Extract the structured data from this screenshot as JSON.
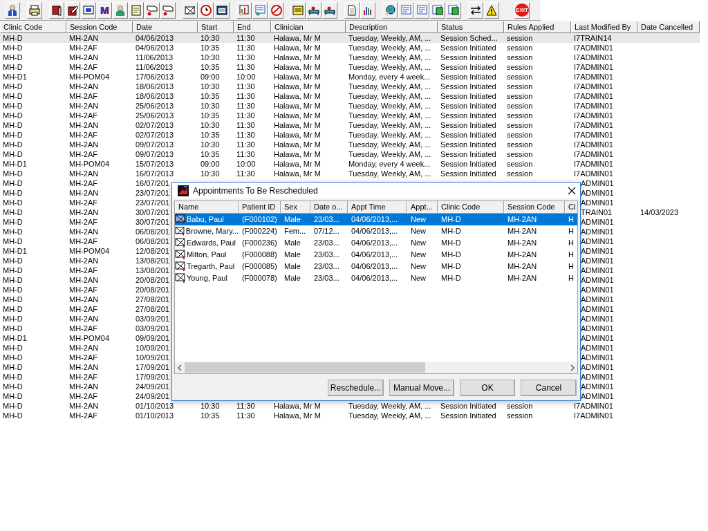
{
  "toolbar": {
    "letter_button": "M",
    "exit_button": "EXIT"
  },
  "table": {
    "columns": [
      "Clinic Code",
      "Session Code",
      "Date",
      "Start",
      "End",
      "Clinician",
      "Description",
      "Status",
      "Rules Applied",
      "Last Modified By",
      "Date Cancelled"
    ],
    "rows": [
      {
        "kind": "full",
        "selected": true,
        "cells": [
          "MH-D",
          "MH-2AN",
          "04/06/2013",
          "10:30",
          "11:30",
          "Halawa, Mr M",
          "Tuesday, Weekly, AM, ...",
          "Session Sched...",
          "session",
          "I7TRAIN14"
        ]
      },
      {
        "kind": "full",
        "selected": false,
        "cells": [
          "MH-D",
          "MH-2AF",
          "04/06/2013",
          "10:35",
          "11:30",
          "Halawa, Mr M",
          "Tuesday, Weekly, AM, ...",
          "Session Initiated",
          "session",
          "I7ADMIN01"
        ]
      },
      {
        "kind": "full",
        "selected": false,
        "cells": [
          "MH-D",
          "MH-2AN",
          "11/06/2013",
          "10:30",
          "11:30",
          "Halawa, Mr M",
          "Tuesday, Weekly, AM, ...",
          "Session Initiated",
          "session",
          "I7ADMIN01"
        ]
      },
      {
        "kind": "full",
        "selected": false,
        "cells": [
          "MH-D",
          "MH-2AF",
          "11/06/2013",
          "10:35",
          "11:30",
          "Halawa, Mr M",
          "Tuesday, Weekly, AM, ...",
          "Session Initiated",
          "session",
          "I7ADMIN01"
        ]
      },
      {
        "kind": "full",
        "selected": false,
        "cells": [
          "MH-D1",
          "MH-POM04",
          "17/06/2013",
          "09:00",
          "10:00",
          "Halawa, Mr M",
          "Monday, every 4 week...",
          "Session Initiated",
          "session",
          "I7ADMIN01"
        ]
      },
      {
        "kind": "full",
        "selected": false,
        "cells": [
          "MH-D",
          "MH-2AN",
          "18/06/2013",
          "10:30",
          "11:30",
          "Halawa, Mr M",
          "Tuesday, Weekly, AM, ...",
          "Session Initiated",
          "session",
          "I7ADMIN01"
        ]
      },
      {
        "kind": "full",
        "selected": false,
        "cells": [
          "MH-D",
          "MH-2AF",
          "18/06/2013",
          "10:35",
          "11:30",
          "Halawa, Mr M",
          "Tuesday, Weekly, AM, ...",
          "Session Initiated",
          "session",
          "I7ADMIN01"
        ]
      },
      {
        "kind": "full",
        "selected": false,
        "cells": [
          "MH-D",
          "MH-2AN",
          "25/06/2013",
          "10:30",
          "11:30",
          "Halawa, Mr M",
          "Tuesday, Weekly, AM, ...",
          "Session Initiated",
          "session",
          "I7ADMIN01"
        ]
      },
      {
        "kind": "full",
        "selected": false,
        "cells": [
          "MH-D",
          "MH-2AF",
          "25/06/2013",
          "10:35",
          "11:30",
          "Halawa, Mr M",
          "Tuesday, Weekly, AM, ...",
          "Session Initiated",
          "session",
          "I7ADMIN01"
        ]
      },
      {
        "kind": "full",
        "selected": false,
        "cells": [
          "MH-D",
          "MH-2AN",
          "02/07/2013",
          "10:30",
          "11:30",
          "Halawa, Mr M",
          "Tuesday, Weekly, AM, ...",
          "Session Initiated",
          "session",
          "I7ADMIN01"
        ]
      },
      {
        "kind": "full",
        "selected": false,
        "cells": [
          "MH-D",
          "MH-2AF",
          "02/07/2013",
          "10:35",
          "11:30",
          "Halawa, Mr M",
          "Tuesday, Weekly, AM, ...",
          "Session Initiated",
          "session",
          "I7ADMIN01"
        ]
      },
      {
        "kind": "full",
        "selected": false,
        "cells": [
          "MH-D",
          "MH-2AN",
          "09/07/2013",
          "10:30",
          "11:30",
          "Halawa, Mr M",
          "Tuesday, Weekly, AM, ...",
          "Session Initiated",
          "session",
          "I7ADMIN01"
        ]
      },
      {
        "kind": "full",
        "selected": false,
        "cells": [
          "MH-D",
          "MH-2AF",
          "09/07/2013",
          "10:35",
          "11:30",
          "Halawa, Mr M",
          "Tuesday, Weekly, AM, ...",
          "Session Initiated",
          "session",
          "I7ADMIN01"
        ]
      },
      {
        "kind": "full",
        "selected": false,
        "cells": [
          "MH-D1",
          "MH-POM04",
          "15/07/2013",
          "09:00",
          "10:00",
          "Halawa, Mr M",
          "Monday, every 4 week...",
          "Session Initiated",
          "session",
          "I7ADMIN01"
        ]
      },
      {
        "kind": "full",
        "selected": false,
        "cells": [
          "MH-D",
          "MH-2AN",
          "16/07/2013",
          "10:30",
          "11:30",
          "Halawa, Mr M",
          "Tuesday, Weekly, AM, ...",
          "Session Initiated",
          "session",
          "I7ADMIN01"
        ]
      },
      {
        "kind": "partly_hidden",
        "selected": false,
        "cells": [
          "MH-D",
          "MH-2AF",
          "16/07/201"
        ],
        "last_modified_by": "ADMIN01"
      },
      {
        "kind": "partly_hidden",
        "selected": false,
        "cells": [
          "MH-D",
          "MH-2AN",
          "23/07/201"
        ],
        "last_modified_by": "ADMIN01"
      },
      {
        "kind": "partly_hidden",
        "selected": false,
        "cells": [
          "MH-D",
          "MH-2AF",
          "23/07/201"
        ],
        "last_modified_by": "ADMIN01"
      },
      {
        "kind": "partly_hidden",
        "selected": false,
        "cells": [
          "MH-D",
          "MH-2AN",
          "30/07/201"
        ],
        "last_modified_by": "TRAIN01",
        "date_cancelled": "14/03/2023"
      },
      {
        "kind": "partly_hidden",
        "selected": false,
        "cells": [
          "MH-D",
          "MH-2AF",
          "30/07/201"
        ],
        "last_modified_by": "ADMIN01"
      },
      {
        "kind": "partly_hidden",
        "selected": false,
        "cells": [
          "MH-D",
          "MH-2AN",
          "06/08/201"
        ],
        "last_modified_by": "ADMIN01"
      },
      {
        "kind": "partly_hidden",
        "selected": false,
        "cells": [
          "MH-D",
          "MH-2AF",
          "06/08/201"
        ],
        "last_modified_by": "ADMIN01"
      },
      {
        "kind": "partly_hidden",
        "selected": false,
        "cells": [
          "MH-D1",
          "MH-POM04",
          "12/08/201"
        ],
        "last_modified_by": "ADMIN01"
      },
      {
        "kind": "partly_hidden",
        "selected": false,
        "cells": [
          "MH-D",
          "MH-2AN",
          "13/08/201"
        ],
        "last_modified_by": "ADMIN01"
      },
      {
        "kind": "partly_hidden",
        "selected": false,
        "cells": [
          "MH-D",
          "MH-2AF",
          "13/08/201"
        ],
        "last_modified_by": "ADMIN01"
      },
      {
        "kind": "partly_hidden",
        "selected": false,
        "cells": [
          "MH-D",
          "MH-2AN",
          "20/08/201"
        ],
        "last_modified_by": "ADMIN01"
      },
      {
        "kind": "partly_hidden",
        "selected": false,
        "cells": [
          "MH-D",
          "MH-2AF",
          "20/08/201"
        ],
        "last_modified_by": "ADMIN01"
      },
      {
        "kind": "partly_hidden",
        "selected": false,
        "cells": [
          "MH-D",
          "MH-2AN",
          "27/08/201"
        ],
        "last_modified_by": "ADMIN01"
      },
      {
        "kind": "partly_hidden",
        "selected": false,
        "cells": [
          "MH-D",
          "MH-2AF",
          "27/08/201"
        ],
        "last_modified_by": "ADMIN01"
      },
      {
        "kind": "partly_hidden",
        "selected": false,
        "cells": [
          "MH-D",
          "MH-2AN",
          "03/09/201"
        ],
        "last_modified_by": "ADMIN01"
      },
      {
        "kind": "partly_hidden",
        "selected": false,
        "cells": [
          "MH-D",
          "MH-2AF",
          "03/09/201"
        ],
        "last_modified_by": "ADMIN01"
      },
      {
        "kind": "partly_hidden",
        "selected": false,
        "cells": [
          "MH-D1",
          "MH-POM04",
          "09/09/201"
        ],
        "last_modified_by": "ADMIN01"
      },
      {
        "kind": "partly_hidden",
        "selected": false,
        "cells": [
          "MH-D",
          "MH-2AN",
          "10/09/201"
        ],
        "last_modified_by": "ADMIN01"
      },
      {
        "kind": "partly_hidden",
        "selected": false,
        "cells": [
          "MH-D",
          "MH-2AF",
          "10/09/201"
        ],
        "last_modified_by": "ADMIN01"
      },
      {
        "kind": "partly_hidden",
        "selected": false,
        "cells": [
          "MH-D",
          "MH-2AN",
          "17/09/201"
        ],
        "last_modified_by": "ADMIN01"
      },
      {
        "kind": "partly_hidden",
        "selected": false,
        "cells": [
          "MH-D",
          "MH-2AF",
          "17/09/201"
        ],
        "last_modified_by": "ADMIN01"
      },
      {
        "kind": "partly_hidden",
        "selected": false,
        "cells": [
          "MH-D",
          "MH-2AN",
          "24/09/201"
        ],
        "last_modified_by": "ADMIN01"
      },
      {
        "kind": "partly_hidden",
        "selected": false,
        "cells": [
          "MH-D",
          "MH-2AF",
          "24/09/201"
        ],
        "last_modified_by": "ADMIN01"
      },
      {
        "kind": "full",
        "selected": false,
        "cells": [
          "MH-D",
          "MH-2AN",
          "01/10/2013",
          "10:30",
          "11:30",
          "Halawa, Mr M",
          "Tuesday, Weekly, AM, ...",
          "Session Initiated",
          "session",
          "I7ADMIN01"
        ]
      },
      {
        "kind": "full",
        "selected": false,
        "cells": [
          "MH-D",
          "MH-2AF",
          "01/10/2013",
          "10:35",
          "11:30",
          "Halawa, Mr M",
          "Tuesday, Weekly, AM, ...",
          "Session Initiated",
          "session",
          "I7ADMIN01"
        ]
      }
    ]
  },
  "dialog": {
    "title": "Appointments To Be Rescheduled",
    "columns": [
      "Name",
      "Patient ID",
      "Sex",
      "Date o...",
      "Appt Time",
      "Appt...",
      "Clinic Code",
      "Session Code",
      "Cl"
    ],
    "rows": [
      {
        "selected": true,
        "cells": [
          "Babu, Paul",
          "(F000102)",
          "Male",
          "23/03...",
          "04/06/2013,...",
          "New",
          "MH-D",
          "MH-2AN",
          "H"
        ]
      },
      {
        "selected": false,
        "cells": [
          "Browne, Mary...",
          "(F000224)",
          "Fem...",
          "07/12...",
          "04/06/2013,...",
          "New",
          "MH-D",
          "MH-2AN",
          "H"
        ]
      },
      {
        "selected": false,
        "cells": [
          "Edwards, Paul",
          "(F000236)",
          "Male",
          "23/03...",
          "04/06/2013,...",
          "New",
          "MH-D",
          "MH-2AN",
          "H"
        ]
      },
      {
        "selected": false,
        "cells": [
          "Milton, Paul",
          "(F000088)",
          "Male",
          "23/03...",
          "04/06/2013,...",
          "New",
          "MH-D",
          "MH-2AN",
          "H"
        ]
      },
      {
        "selected": false,
        "cells": [
          "Tregarth, Paul",
          "(F000085)",
          "Male",
          "23/03...",
          "04/06/2013,...",
          "New",
          "MH-D",
          "MH-2AN",
          "H"
        ]
      },
      {
        "selected": false,
        "cells": [
          "Young, Paul",
          "(F000078)",
          "Male",
          "23/03...",
          "04/06/2013,...",
          "New",
          "MH-D",
          "MH-2AN",
          "H"
        ]
      }
    ],
    "buttons": [
      "Reschedule...",
      "Manual Move...",
      "OK",
      "Cancel"
    ]
  }
}
